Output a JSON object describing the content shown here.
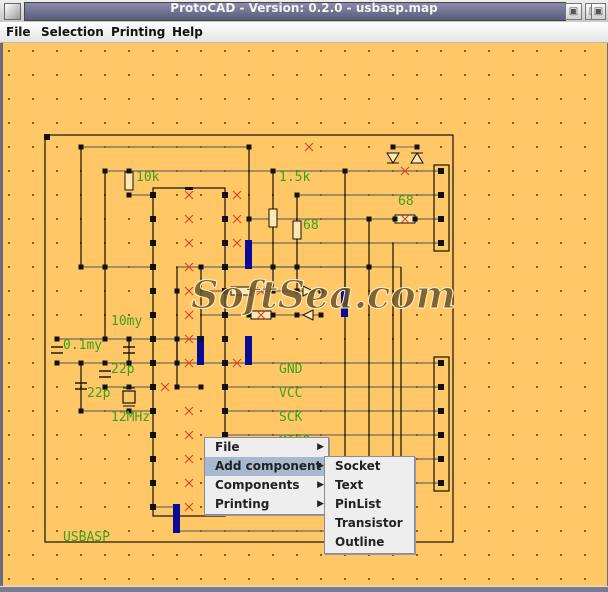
{
  "window": {
    "title": "ProtoCAD - Version: 0.2.0 - usbasp.map",
    "buttons": [
      "minimize",
      "maximize",
      "close"
    ]
  },
  "menubar": {
    "items": [
      {
        "label": "File",
        "mnemonic": "F"
      },
      {
        "label": "Selection",
        "mnemonic": "S"
      },
      {
        "label": "Printing"
      },
      {
        "label": "Help"
      }
    ]
  },
  "canvas": {
    "background": "#ffc766",
    "labels": {
      "r1": "10k",
      "r2": "1.5k",
      "r3": "68",
      "r4": "68",
      "c1": "10my",
      "c2": "0.1my",
      "c3": "22p",
      "c4": "22p",
      "xtal": "12MHz",
      "gnd": "GND",
      "vcc": "VCC",
      "sck": "SCK",
      "miso": "MISO",
      "board": "USBASP"
    },
    "watermark": "SoftSea.com",
    "colors": {
      "wire": "#6b6b5a",
      "label": "#3ca21a",
      "cross": "#e03a1a",
      "jumper": "#0a0a9a",
      "grid_dot": "#9a5a10"
    }
  },
  "context_menu": {
    "items": [
      {
        "label": "File",
        "submenu": true,
        "selected": false
      },
      {
        "label": "Add component",
        "submenu": true,
        "selected": true
      },
      {
        "label": "Components",
        "submenu": true,
        "selected": false
      },
      {
        "label": "Printing",
        "submenu": true,
        "selected": false
      }
    ],
    "submenu": {
      "items": [
        "Socket",
        "Text",
        "PinList",
        "Transistor",
        "Outline"
      ]
    }
  }
}
